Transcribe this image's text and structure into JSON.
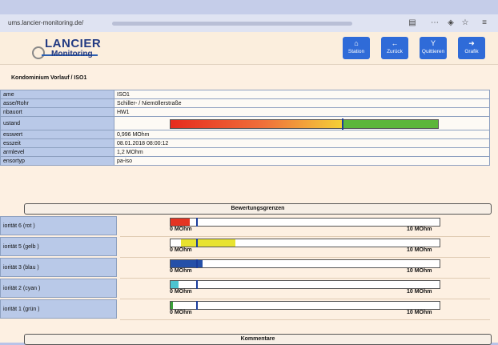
{
  "browser": {
    "url": "ums.lancier-monitoring.de/"
  },
  "header": {
    "logo_top": "LANCIER",
    "logo_bottom": "Monitoring",
    "buttons": [
      {
        "label": "Station",
        "icon": "⌂"
      },
      {
        "label": "Zurück",
        "icon": "←"
      },
      {
        "label": "Quittieren",
        "icon": "Y"
      },
      {
        "label": "Grafik",
        "icon": "➜"
      }
    ]
  },
  "page_title": "Kondominium Vorlauf / ISO1",
  "info": [
    {
      "key": "ame",
      "value": "ISO1"
    },
    {
      "key": "asse/Rohr",
      "value": "Schiller- / Niemöllerstraße"
    },
    {
      "key": "nbauort",
      "value": "HW1"
    },
    {
      "key": "ustand",
      "value": ""
    },
    {
      "key": "esswert",
      "value": "0,996 MOhm"
    },
    {
      "key": "esszeit",
      "value": "08.01.2018 08:00:12"
    },
    {
      "key": "armlevel",
      "value": "1,2 MOhm"
    },
    {
      "key": "ensortyp",
      "value": "pa-iso"
    }
  ],
  "status_bar": {
    "level": 0.64,
    "colors": [
      "#e62b1e",
      "#f5d234",
      "#5cb63a"
    ]
  },
  "sections": {
    "bewertung": "Bewertungsgrenzen",
    "kommentare": "Kommentare"
  },
  "priorities": [
    {
      "label": "iorität 6 (rot )",
      "color": "#e53422",
      "start": 0.0,
      "end": 0.07,
      "min": "0 MOhm",
      "max": "10 MOhm"
    },
    {
      "label": "iorität 5 (gelb )",
      "color": "#e8e330",
      "start": 0.04,
      "end": 0.24,
      "min": "0 MOhm",
      "max": "10 MOhm"
    },
    {
      "label": "iorität 3 (blau )",
      "color": "#2550a8",
      "start": 0.0,
      "end": 0.12,
      "min": "0 MOhm",
      "max": "10 MOhm"
    },
    {
      "label": "iorität 2 (cyan )",
      "color": "#4cc3cf",
      "start": 0.0,
      "end": 0.03,
      "min": "0 MOhm",
      "max": "10 MOhm"
    },
    {
      "label": "iorität 1 (grün )",
      "color": "#3aa338",
      "start": 0.0,
      "end": 0.01,
      "min": "0 MOhm",
      "max": "10 MOhm"
    }
  ]
}
